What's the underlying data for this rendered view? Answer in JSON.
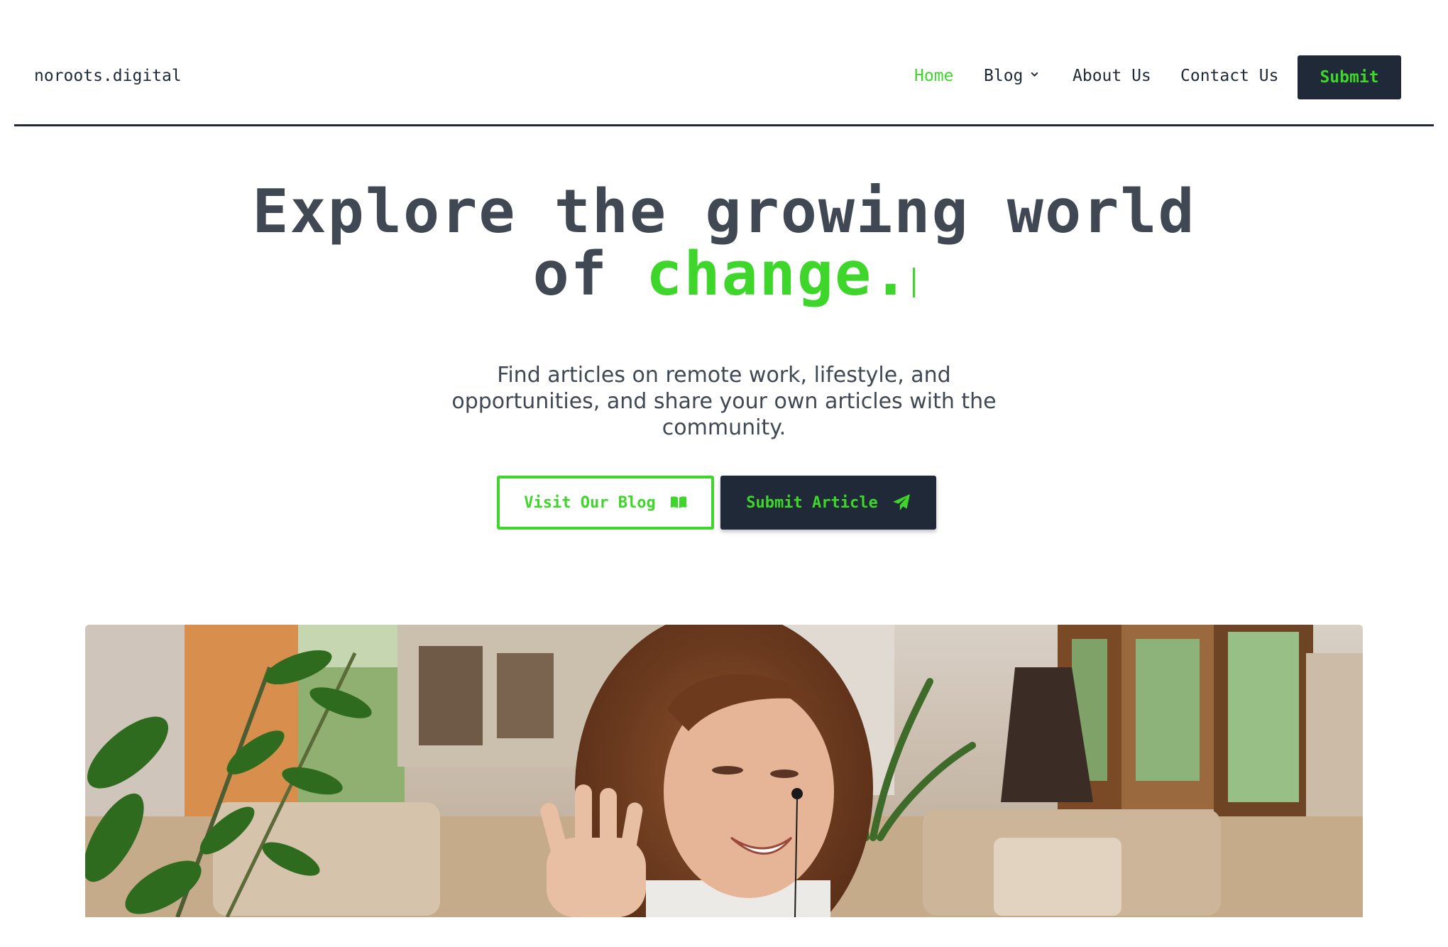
{
  "header": {
    "logo": "noroots.digital",
    "nav": [
      {
        "label": "Home",
        "active": true
      },
      {
        "label": "Blog",
        "dropdown": true
      },
      {
        "label": "About Us"
      },
      {
        "label": "Contact Us"
      }
    ],
    "submit_label": "Submit"
  },
  "hero": {
    "title_line1": "Explore the growing world",
    "title_line2_prefix": "of ",
    "title_line2_accent": "change.",
    "subtitle": "Find articles on remote work, lifestyle, and opportunities, and share your own articles with the community.",
    "buttons": {
      "blog_label": "Visit Our Blog",
      "blog_icon": "book-open-icon",
      "submit_label": "Submit Article",
      "submit_icon": "paper-plane-icon"
    }
  },
  "colors": {
    "accent": "#3ed62b",
    "dark": "#1f2937",
    "heading": "#404853"
  },
  "photo": {
    "subject": "woman-waving-video-call-photo"
  }
}
